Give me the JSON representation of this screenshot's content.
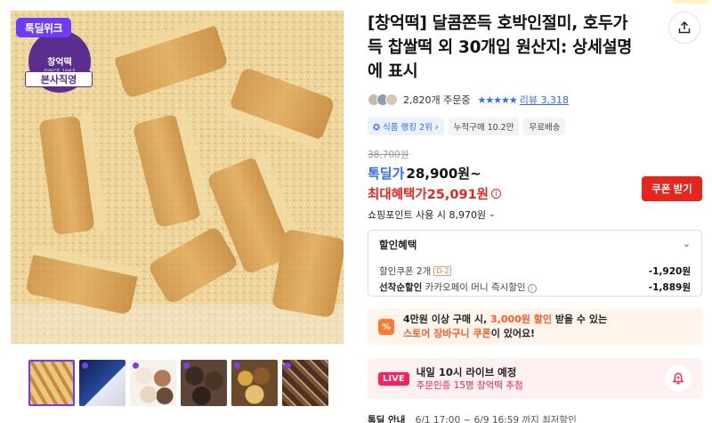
{
  "media": {
    "deal_badge": "톡딜위크",
    "seal_name": "창억떡",
    "seal_since": "SINCE 1963",
    "seal_ribbon": "본사직영",
    "thumbnails": [
      "thumb-1",
      "thumb-2",
      "thumb-3",
      "thumb-4",
      "thumb-5",
      "thumb-6"
    ]
  },
  "product": {
    "title": "[창억떡] 달콤쫀득 호박인절미, 호두가득 찹쌀떡 외 30개입 원산지: 상세설명에 표시",
    "share_icon": "share-icon"
  },
  "meta": {
    "orders": "2,820개 주문중",
    "stars": "★★★★★",
    "review_label": "리뷰 3,318"
  },
  "tags": [
    "식품 랭킹 2위 ›",
    "누적구매 10.2만",
    "무료배송"
  ],
  "price": {
    "original": "38,700원",
    "deal_label": "톡딜가",
    "deal_price": "28,900원~",
    "max_benefit": "최대혜택가25,091원",
    "info_glyph": "i",
    "coupon_button": "쿠폰 받기",
    "points": "쇼핑포인트 사용 시 8,970원"
  },
  "discount": {
    "header": "할인혜택",
    "coupon_label": "할인쿠폰 2개",
    "coupon_dday": "D-2",
    "coupon_amount": "-1,920원",
    "first_come_label": "선착순할인",
    "first_come_desc": "카카오페이 머니 즉시할인",
    "first_come_amount": "-1,889원"
  },
  "promo": {
    "icon_glyph": "%",
    "line1_a": "4만원 이상 구매 시, ",
    "line1_b": "3,000원 할인",
    "line1_c": " 받을 수 있는",
    "line2_a": "스토어 장바구니 쿠폰",
    "line2_b": "이 있어요!"
  },
  "live": {
    "tag": "LIVE",
    "title": "내일 10시 라이브 예정",
    "subtitle": "주문인증 15명 창억떡 추첨"
  },
  "bottom": {
    "label": "톡딜 안내",
    "text": "6/1 17:00 ~ 6/9 16:59 까지 최저할인"
  },
  "colors": {
    "brand_purple": "#6a3cff",
    "accent_blue": "#2f6bff",
    "sale_red": "#e8251d",
    "promo_orange": "#ff5a1f",
    "live_pink": "#ff1f5a"
  }
}
